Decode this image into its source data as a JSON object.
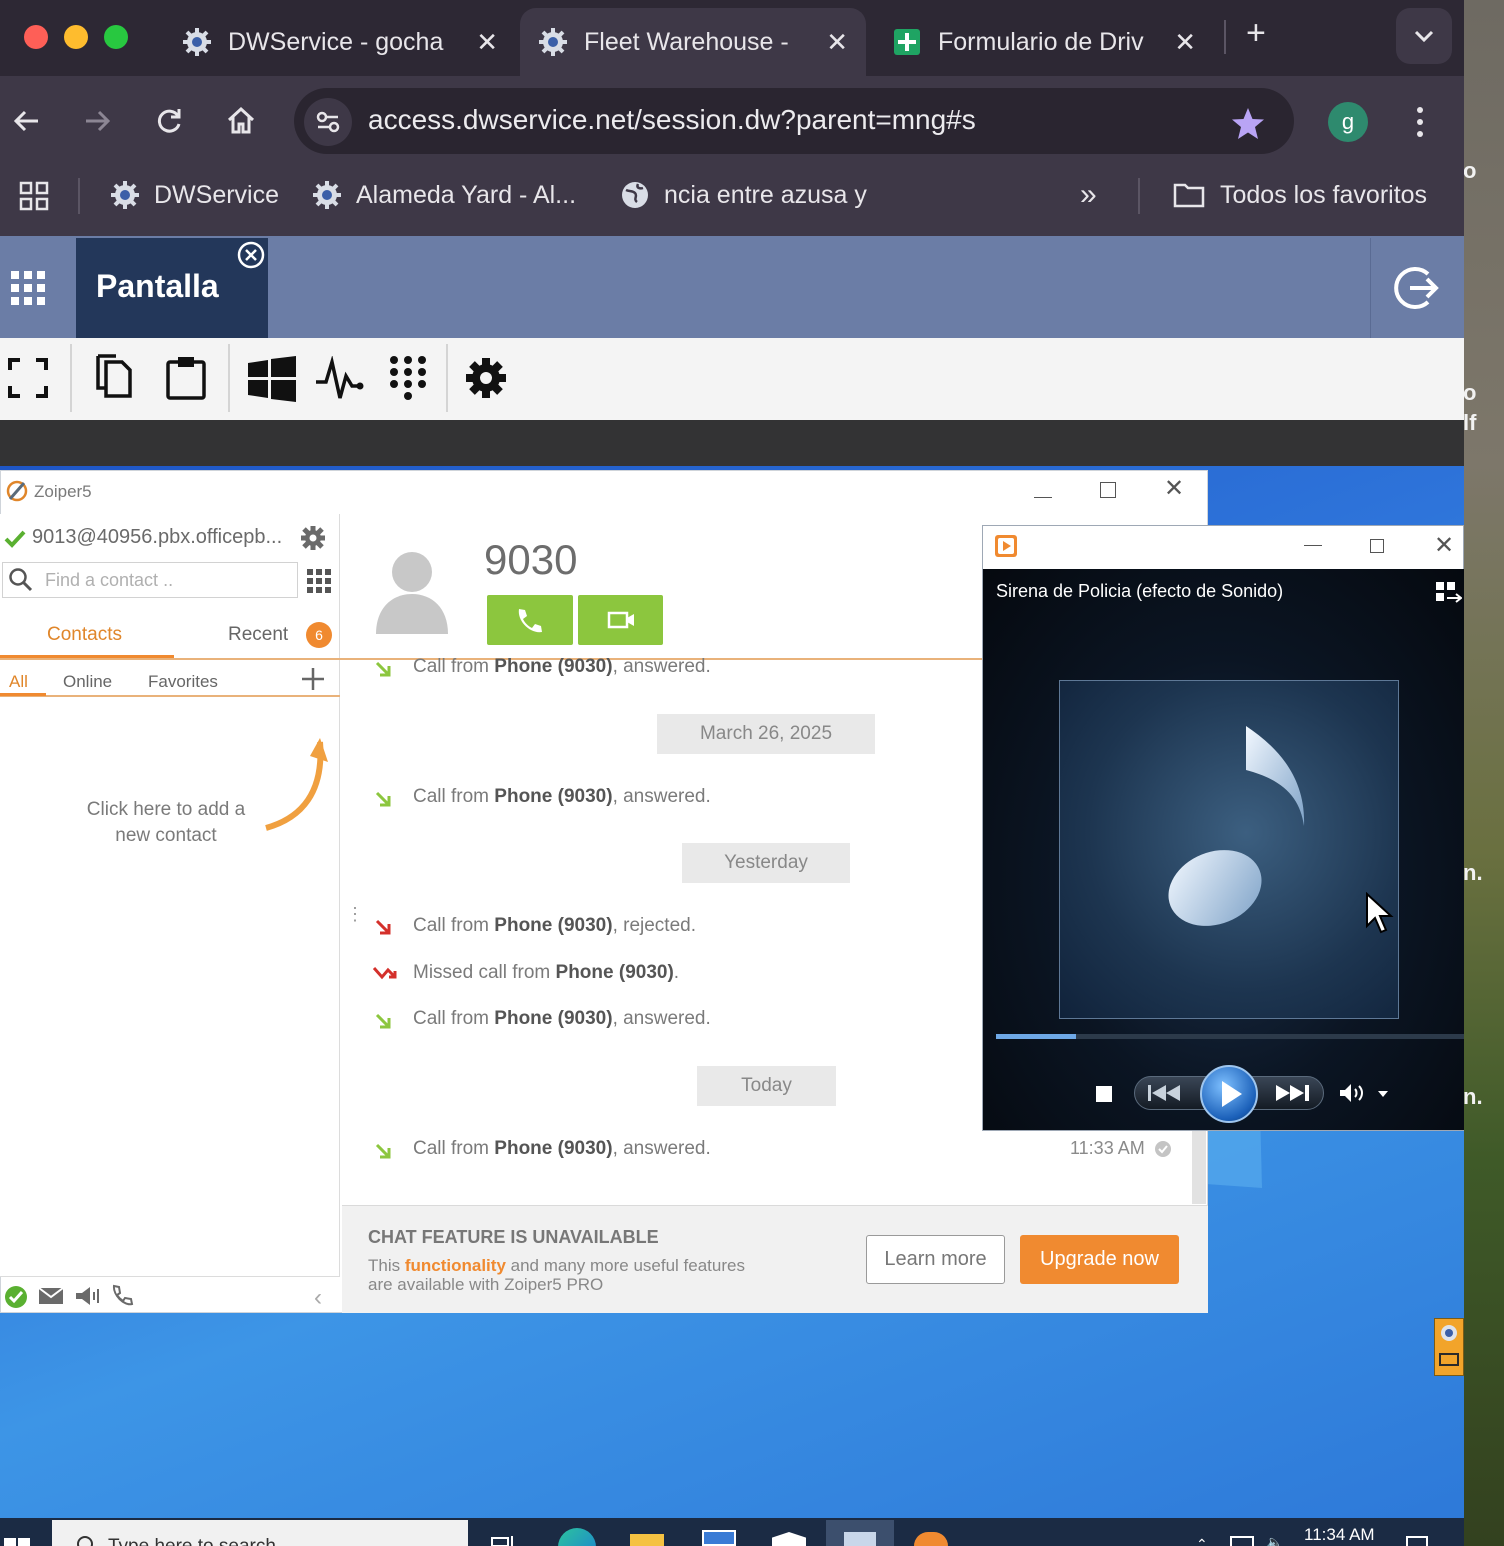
{
  "browser": {
    "tabs": [
      {
        "title": "DWService - gocha",
        "icon": "dwservice-gear-icon"
      },
      {
        "title": "Fleet Warehouse -",
        "icon": "dwservice-gear-icon"
      },
      {
        "title": "Formulario de Driv",
        "icon": "google-sheets-icon"
      }
    ],
    "url": "access.dwservice.net/session.dw?parent=mng#s",
    "profile_initial": "g",
    "bookmarks": [
      {
        "label": "DWService",
        "icon": "dwservice-gear-icon"
      },
      {
        "label": "Alameda Yard - Al...",
        "icon": "dwservice-gear-icon"
      },
      {
        "label": "ncia entre azusa y",
        "icon": "globe-icon"
      }
    ],
    "all_bookmarks": "Todos los favoritos"
  },
  "dwservice": {
    "title": "Pantalla"
  },
  "zoiper": {
    "app_title": "Zoiper5",
    "account": "9013@40956.pbx.officepb...",
    "search_placeholder": "Find a contact ..",
    "tabs": {
      "contacts": "Contacts",
      "recent": "Recent",
      "recent_badge": "6"
    },
    "filters": {
      "all": "All",
      "online": "Online",
      "favorites": "Favorites"
    },
    "empty_hint_1": "Click here to add a",
    "empty_hint_2": "new contact",
    "contact_number": "9030",
    "history": [
      {
        "prefix": "Call from",
        "name": "Phone (9030)",
        "suffix": ", answered.",
        "status": "answered"
      },
      {
        "date": "March 26, 2025"
      },
      {
        "prefix": "Call from",
        "name": "Phone (9030)",
        "suffix": ", answered.",
        "status": "answered"
      },
      {
        "date": "Yesterday"
      },
      {
        "prefix": "Call from",
        "name": "Phone (9030)",
        "suffix": ", rejected.",
        "status": "rejected"
      },
      {
        "prefix": "Missed call from",
        "name": "Phone (9030)",
        "suffix": ".",
        "status": "missed"
      },
      {
        "prefix": "Call from",
        "name": "Phone (9030)",
        "suffix": ", answered.",
        "status": "answered"
      },
      {
        "date": "Today"
      },
      {
        "prefix": "Call from",
        "name": "Phone (9030)",
        "suffix": ", answered.",
        "status": "answered",
        "time": "11:33 AM"
      }
    ],
    "chat": {
      "heading": "CHAT FEATURE IS UNAVAILABLE",
      "line1_a": "This ",
      "line1_b": "functionality",
      "line1_c": " and many more useful features",
      "line2": "are available with Zoiper5 PRO",
      "learn_more": "Learn more",
      "upgrade": "Upgrade now"
    }
  },
  "media_player": {
    "now_playing": "Sirena de Policia (efecto de Sonido)",
    "progress_fraction": 0.17
  },
  "taskbar": {
    "search_placeholder": "Type here to search",
    "clock": "11:34 AM"
  },
  "colors": {
    "accent_orange": "#f08a30",
    "call_green": "#8cc63e",
    "dw_blue": "#6b7da6",
    "dw_navy": "#23375a"
  }
}
